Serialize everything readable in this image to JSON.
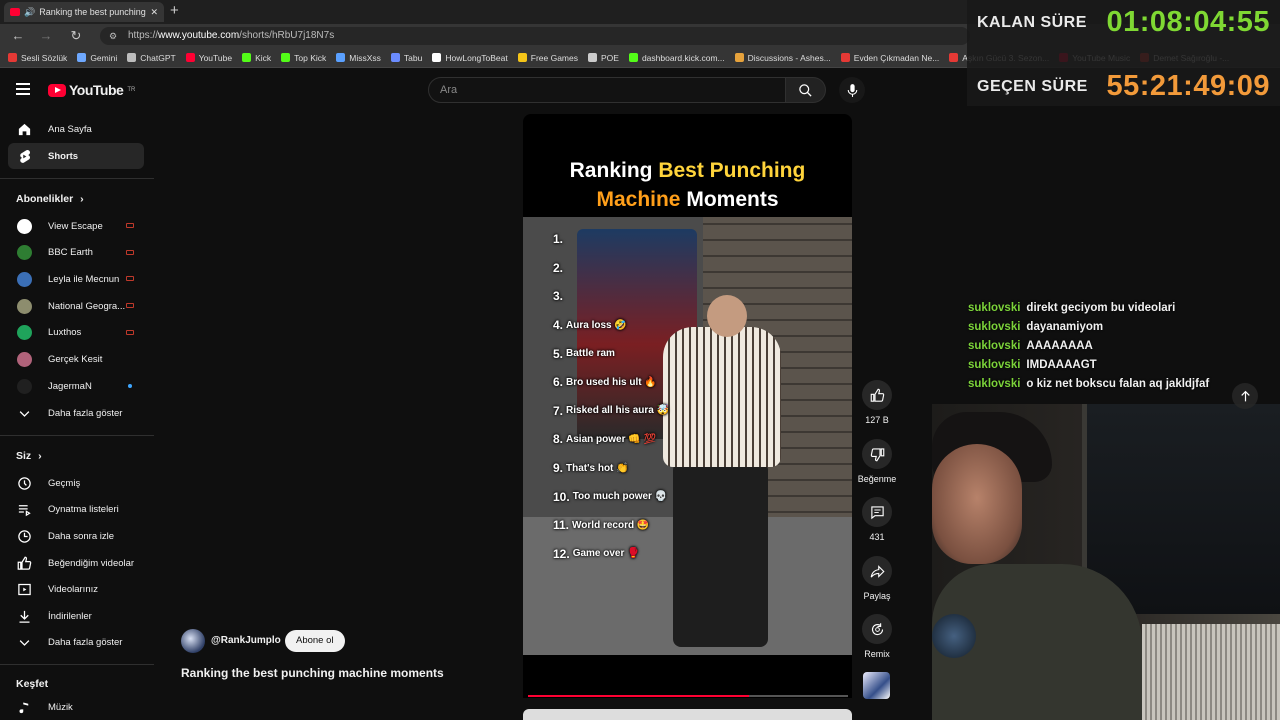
{
  "browser": {
    "tab_title": "Ranking the best punching m",
    "new_tab": "+",
    "url_prefix": "https://",
    "url_host": "www.youtube.com",
    "url_path": "/shorts/hRbU7j18N7s",
    "bookmarks": [
      {
        "label": "Sesli Sözlük",
        "color": "#e53935"
      },
      {
        "label": "Gemini",
        "color": "#6ea8fe"
      },
      {
        "label": "ChatGPT",
        "color": "#bdbdbd"
      },
      {
        "label": "YouTube",
        "color": "#ff0033"
      },
      {
        "label": "Kick",
        "color": "#53fc18"
      },
      {
        "label": "Top Kick",
        "color": "#53fc18"
      },
      {
        "label": "MissXss",
        "color": "#5aa0ff"
      },
      {
        "label": "Tabu",
        "color": "#6b8cff"
      },
      {
        "label": "HowLongToBeat",
        "color": "#ffffff"
      },
      {
        "label": "Free Games",
        "color": "#f5c518"
      },
      {
        "label": "POE",
        "color": "#cccccc"
      },
      {
        "label": "dashboard.kick.com...",
        "color": "#53fc18"
      },
      {
        "label": "Discussions - Ashes...",
        "color": "#e6a23c"
      },
      {
        "label": "Evden Çıkmadan Ne...",
        "color": "#e53935"
      },
      {
        "label": "Aşkın Gücü 3. Sezon...",
        "color": "#e53935"
      },
      {
        "label": "YouTube Music",
        "color": "#ff0033"
      },
      {
        "label": "Demet Sağıroğlu -...",
        "color": "#e53935"
      }
    ]
  },
  "header": {
    "logo_text": "YouTube",
    "logo_region": "TR",
    "search_placeholder": "Ara"
  },
  "sidebar": {
    "main": [
      {
        "label": "Ana Sayfa",
        "icon": "home-icon"
      },
      {
        "label": "Shorts",
        "icon": "shorts-icon"
      }
    ],
    "subs_heading": "Abonelikler",
    "subscriptions": [
      {
        "label": "View Escape",
        "color": "#ffffff",
        "live": true
      },
      {
        "label": "BBC Earth",
        "color": "#2e7d32",
        "live": true
      },
      {
        "label": "Leyla ile Mecnun",
        "color": "#3b6fb6",
        "live": true
      },
      {
        "label": "National Geogra...",
        "color": "#8d8d6e",
        "live": true
      },
      {
        "label": "Luxthos",
        "color": "#1fa35b",
        "live": true
      },
      {
        "label": "Gerçek Kesit",
        "color": "#b0637a",
        "live": false
      },
      {
        "label": "JagermaN",
        "color": "#202020",
        "live": false,
        "new": true
      }
    ],
    "more_subs": "Daha fazla göster",
    "you_heading": "Siz",
    "you": [
      {
        "label": "Geçmiş",
        "icon": "history-icon"
      },
      {
        "label": "Oynatma listeleri",
        "icon": "playlists-icon"
      },
      {
        "label": "Daha sonra izle",
        "icon": "watch-later-icon"
      },
      {
        "label": "Beğendiğim videolar",
        "icon": "liked-icon"
      },
      {
        "label": "Videolarınız",
        "icon": "your-videos-icon"
      },
      {
        "label": "İndirilenler",
        "icon": "downloads-icon"
      }
    ],
    "more_you": "Daha fazla göster",
    "explore_heading": "Keşfet",
    "explore": [
      {
        "label": "Müzik",
        "icon": "music-icon"
      }
    ]
  },
  "short": {
    "title_line1_a": "Ranking ",
    "title_line1_b": "Best Punching",
    "title_line2_a": "Machine",
    "title_line2_b": " Moments",
    "ranks": [
      {
        "n": "1.",
        "text": ""
      },
      {
        "n": "2.",
        "text": ""
      },
      {
        "n": "3.",
        "text": ""
      },
      {
        "n": "4.",
        "text": "Aura loss 🤣"
      },
      {
        "n": "5.",
        "text": "Battle ram"
      },
      {
        "n": "6.",
        "text": "Bro used his ult 🔥"
      },
      {
        "n": "7.",
        "text": "Risked all his aura 🤯"
      },
      {
        "n": "8.",
        "text": "Asian power 👊 💯"
      },
      {
        "n": "9.",
        "text": "That's hot 👏"
      },
      {
        "n": "10.",
        "text": "Too much power 💀"
      },
      {
        "n": "11.",
        "text": "World record 🤩"
      },
      {
        "n": "12.",
        "text": "Game over 🥊"
      }
    ],
    "progress": 0.69,
    "channel": "@RankJumplo",
    "subscribe": "Abone ol",
    "video_title": "Ranking the best punching machine moments"
  },
  "actions": {
    "like_count": "127 B",
    "dislike_label": "Beğenme",
    "comments_count": "431",
    "share_label": "Paylaş",
    "remix_label": "Remix"
  },
  "overlay": {
    "remaining_label": "KALAN SÜRE",
    "remaining_value": "01:08:04:55",
    "elapsed_label": "GEÇEN SÜRE",
    "elapsed_value": "55:21:49:09"
  },
  "chat": [
    {
      "user": "suklovski",
      "text": "direkt geciyom bu videolari"
    },
    {
      "user": "suklovski",
      "text": "dayanamiyom"
    },
    {
      "user": "suklovski",
      "text": "AAAAAAAA"
    },
    {
      "user": "suklovski",
      "text": "IMDAAAAGT"
    },
    {
      "user": "suklovski",
      "text": "o kiz net bokscu falan aq jakldjfaf"
    }
  ]
}
